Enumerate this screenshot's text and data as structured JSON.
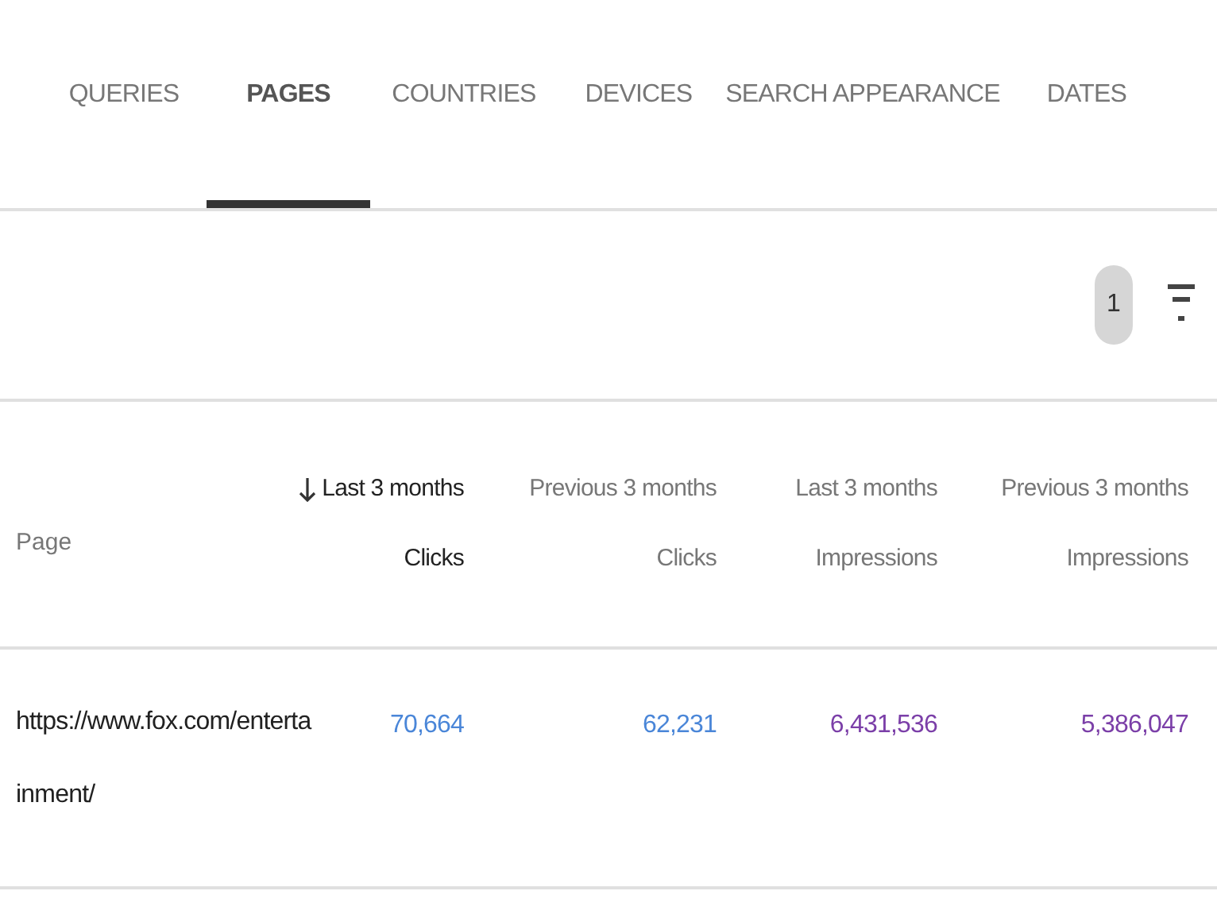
{
  "tabs": [
    {
      "label": "QUERIES",
      "selected": false
    },
    {
      "label": "PAGES",
      "selected": true
    },
    {
      "label": "COUNTRIES",
      "selected": false
    },
    {
      "label": "DEVICES",
      "selected": false
    },
    {
      "label": "SEARCH APPEARANCE",
      "selected": false
    },
    {
      "label": "DATES",
      "selected": false
    }
  ],
  "filter_bar": {
    "active_filter_count": "1"
  },
  "table": {
    "columns": [
      {
        "kind": "dimension",
        "label": "Page",
        "sorted": false
      },
      {
        "kind": "clicks",
        "period": "Last 3 months",
        "label": "Clicks",
        "sorted": true
      },
      {
        "kind": "clicks",
        "period": "Previous 3 months",
        "label": "Clicks",
        "sorted": false
      },
      {
        "kind": "impressions",
        "period": "Last 3 months",
        "label": "Impressions",
        "sorted": false
      },
      {
        "kind": "impressions",
        "period": "Previous 3 months",
        "label": "Impressions",
        "sorted": false
      }
    ],
    "rows": [
      {
        "cells": [
          "https://www.fox.com/entertainment/",
          "70,664",
          "62,231",
          "6,431,536",
          "5,386,047"
        ]
      }
    ]
  }
}
